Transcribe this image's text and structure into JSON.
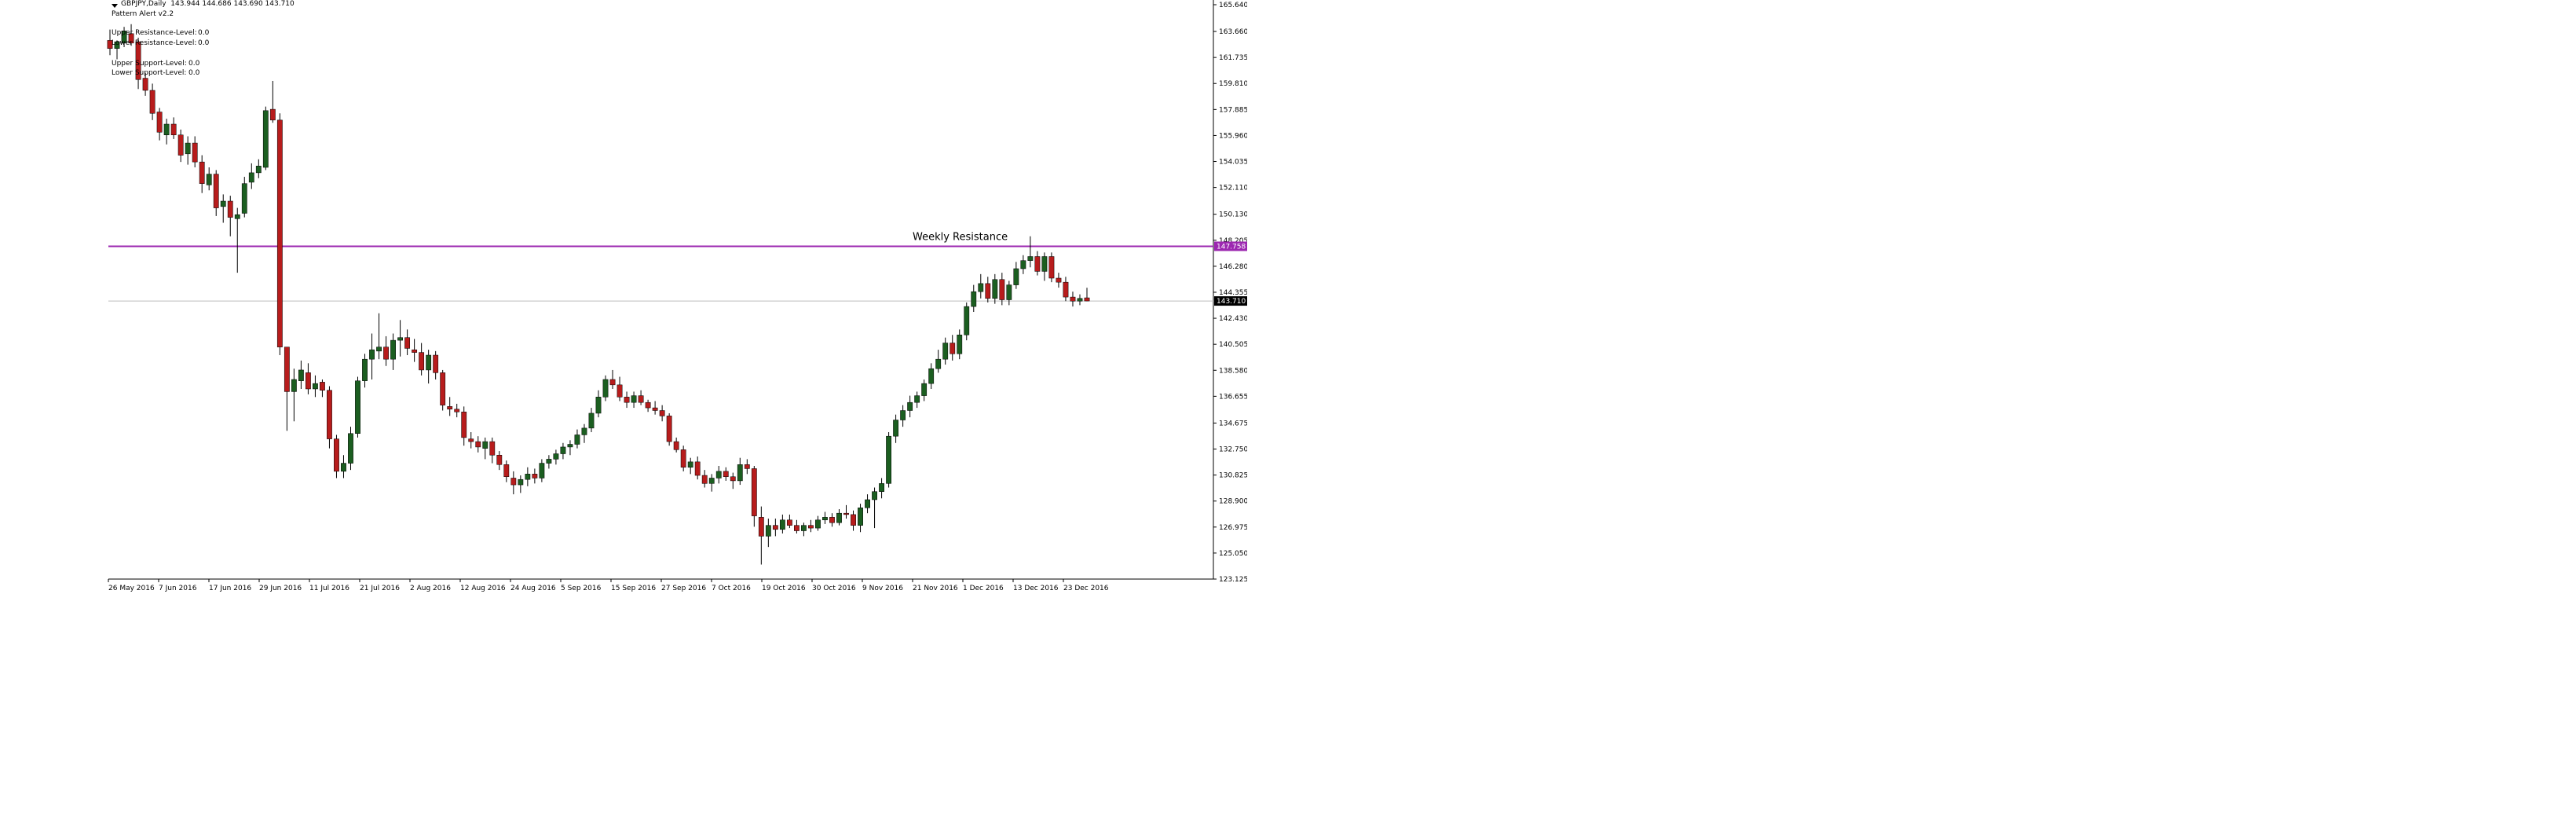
{
  "header": {
    "symbol_line": "GBPJPY,Daily  143.944 144.686 143.690 143.710",
    "pattern_alert": "Pattern Alert v2.2"
  },
  "levels": [
    {
      "label": "Upper Resistance-Level:",
      "value": "0.0"
    },
    {
      "label": "Lower Resistance-Level:",
      "value": "0.0"
    },
    {
      "label": "Upper Support-Level:",
      "value": "0.0"
    },
    {
      "label": "Lower Support-Level:",
      "value": "0.0"
    }
  ],
  "colors": {
    "bull": "#1b5e20",
    "bear": "#b71c1c",
    "wick": "#000000",
    "resistance": "#9c27b0",
    "price_line": "#bdbdbd",
    "axis": "#000000",
    "price_tag_bg": "#000000",
    "resistance_tag_bg": "#9c27b0"
  },
  "chart_data": {
    "type": "candlestick",
    "symbol": "GBPJPY",
    "timeframe": "Daily",
    "y_axis_ticks": [
      "165.640",
      "163.660",
      "161.735",
      "159.810",
      "157.885",
      "155.960",
      "154.035",
      "152.110",
      "150.130",
      "148.205",
      "146.280",
      "144.355",
      "142.430",
      "140.505",
      "138.580",
      "136.655",
      "134.675",
      "132.750",
      "130.825",
      "128.900",
      "126.975",
      "125.050",
      "123.125"
    ],
    "x_axis_ticks": [
      "26 May 2016",
      "7 Jun 2016",
      "17 Jun 2016",
      "29 Jun 2016",
      "11 Jul 2016",
      "21 Jul 2016",
      "2 Aug 2016",
      "12 Aug 2016",
      "24 Aug 2016",
      "5 Sep 2016",
      "15 Sep 2016",
      "27 Sep 2016",
      "7 Oct 2016",
      "19 Oct 2016",
      "30 Oct 2016",
      "9 Nov 2016",
      "21 Nov 2016",
      "1 Dec 2016",
      "13 Dec 2016",
      "23 Dec 2016"
    ],
    "ylim": [
      123.125,
      165.64
    ],
    "weekly_resistance": {
      "value": 147.758,
      "label": "Weekly Resistance",
      "tag": "147.758"
    },
    "current_price": {
      "value": 143.71,
      "tag": "143.710"
    },
    "candles": [
      [
        163.0,
        163.8,
        161.9,
        162.4
      ],
      [
        162.4,
        163.0,
        161.6,
        162.9
      ],
      [
        162.8,
        164.0,
        162.5,
        163.7
      ],
      [
        163.5,
        164.2,
        162.6,
        162.8
      ],
      [
        162.9,
        163.2,
        159.4,
        160.1
      ],
      [
        160.2,
        160.6,
        158.9,
        159.3
      ],
      [
        159.3,
        159.8,
        157.1,
        157.6
      ],
      [
        157.7,
        158.0,
        155.6,
        156.2
      ],
      [
        156.0,
        157.2,
        155.3,
        156.8
      ],
      [
        156.8,
        157.3,
        155.7,
        156.0
      ],
      [
        156.0,
        156.4,
        154.0,
        154.5
      ],
      [
        154.6,
        155.9,
        153.8,
        155.4
      ],
      [
        155.4,
        155.9,
        153.6,
        154.0
      ],
      [
        154.0,
        154.5,
        151.7,
        152.4
      ],
      [
        152.3,
        153.6,
        151.9,
        153.1
      ],
      [
        153.1,
        153.4,
        150.0,
        150.6
      ],
      [
        150.7,
        151.6,
        149.5,
        151.1
      ],
      [
        151.1,
        151.5,
        148.5,
        149.9
      ],
      [
        149.8,
        150.6,
        145.8,
        150.1
      ],
      [
        150.2,
        152.9,
        149.9,
        152.4
      ],
      [
        152.5,
        153.9,
        152.0,
        153.2
      ],
      [
        153.2,
        154.2,
        152.8,
        153.7
      ],
      [
        153.6,
        158.1,
        153.4,
        157.8
      ],
      [
        157.9,
        160.0,
        156.9,
        157.1
      ],
      [
        157.1,
        157.6,
        139.7,
        140.3
      ],
      [
        140.3,
        137.9,
        134.1,
        137.0
      ],
      [
        137.0,
        138.7,
        134.8,
        137.9
      ],
      [
        137.8,
        139.3,
        137.2,
        138.6
      ],
      [
        138.4,
        139.1,
        136.8,
        137.2
      ],
      [
        137.2,
        138.2,
        136.6,
        137.6
      ],
      [
        137.7,
        137.9,
        136.6,
        137.1
      ],
      [
        137.1,
        137.4,
        132.8,
        133.5
      ],
      [
        133.5,
        133.8,
        130.6,
        131.1
      ],
      [
        131.1,
        132.3,
        130.6,
        131.7
      ],
      [
        131.7,
        134.4,
        131.2,
        133.9
      ],
      [
        133.9,
        138.1,
        133.6,
        137.8
      ],
      [
        137.8,
        139.8,
        137.3,
        139.4
      ],
      [
        139.4,
        141.3,
        137.9,
        140.1
      ],
      [
        140.0,
        142.8,
        139.4,
        140.3
      ],
      [
        140.3,
        141.1,
        138.9,
        139.4
      ],
      [
        139.4,
        141.3,
        138.6,
        140.8
      ],
      [
        140.8,
        142.3,
        139.6,
        141.0
      ],
      [
        141.0,
        141.6,
        139.7,
        140.2
      ],
      [
        140.1,
        140.9,
        139.2,
        139.9
      ],
      [
        139.9,
        140.6,
        138.2,
        138.6
      ],
      [
        138.6,
        140.1,
        137.6,
        139.7
      ],
      [
        139.7,
        140.0,
        137.9,
        138.4
      ],
      [
        138.4,
        138.6,
        135.6,
        136.0
      ],
      [
        135.9,
        136.6,
        135.2,
        135.7
      ],
      [
        135.7,
        136.1,
        135.1,
        135.5
      ],
      [
        135.5,
        135.9,
        133.0,
        133.6
      ],
      [
        133.5,
        134.0,
        132.8,
        133.3
      ],
      [
        133.3,
        133.7,
        132.5,
        132.9
      ],
      [
        132.8,
        133.6,
        132.0,
        133.3
      ],
      [
        133.3,
        133.6,
        131.7,
        132.3
      ],
      [
        132.3,
        132.6,
        131.2,
        131.6
      ],
      [
        131.6,
        131.9,
        130.3,
        130.7
      ],
      [
        130.6,
        131.1,
        129.4,
        130.1
      ],
      [
        130.1,
        130.8,
        129.5,
        130.5
      ],
      [
        130.5,
        131.4,
        130.0,
        130.9
      ],
      [
        130.9,
        131.3,
        130.2,
        130.6
      ],
      [
        130.6,
        132.0,
        130.3,
        131.7
      ],
      [
        131.7,
        132.3,
        131.3,
        132.0
      ],
      [
        132.0,
        132.7,
        131.6,
        132.4
      ],
      [
        132.4,
        133.2,
        132.0,
        132.9
      ],
      [
        132.9,
        133.4,
        132.3,
        133.1
      ],
      [
        133.1,
        134.2,
        132.8,
        133.8
      ],
      [
        133.8,
        134.6,
        133.2,
        134.3
      ],
      [
        134.3,
        135.8,
        134.0,
        135.4
      ],
      [
        135.4,
        137.1,
        135.1,
        136.6
      ],
      [
        136.6,
        138.2,
        136.3,
        137.9
      ],
      [
        137.9,
        138.6,
        137.2,
        137.5
      ],
      [
        137.5,
        138.1,
        136.3,
        136.6
      ],
      [
        136.6,
        137.0,
        135.8,
        136.2
      ],
      [
        136.2,
        137.0,
        135.8,
        136.7
      ],
      [
        136.7,
        137.1,
        136.0,
        136.2
      ],
      [
        136.2,
        136.4,
        135.5,
        135.8
      ],
      [
        135.8,
        136.3,
        135.3,
        135.6
      ],
      [
        135.6,
        136.0,
        134.8,
        135.2
      ],
      [
        135.2,
        135.4,
        133.0,
        133.3
      ],
      [
        133.3,
        133.6,
        132.5,
        132.7
      ],
      [
        132.7,
        133.0,
        131.1,
        131.4
      ],
      [
        131.4,
        132.1,
        130.9,
        131.8
      ],
      [
        131.8,
        132.2,
        130.5,
        130.8
      ],
      [
        130.8,
        131.2,
        129.9,
        130.2
      ],
      [
        130.2,
        130.9,
        129.6,
        130.6
      ],
      [
        130.6,
        131.5,
        130.2,
        131.1
      ],
      [
        131.1,
        131.4,
        130.4,
        130.7
      ],
      [
        130.7,
        131.0,
        129.8,
        130.4
      ],
      [
        130.4,
        132.1,
        130.1,
        131.6
      ],
      [
        131.6,
        132.0,
        130.9,
        131.3
      ],
      [
        131.3,
        131.5,
        127.0,
        127.8
      ],
      [
        127.7,
        128.5,
        124.2,
        126.3
      ],
      [
        126.3,
        127.6,
        125.5,
        127.1
      ],
      [
        127.1,
        127.6,
        126.3,
        126.8
      ],
      [
        126.8,
        127.9,
        126.5,
        127.5
      ],
      [
        127.5,
        127.9,
        126.9,
        127.1
      ],
      [
        127.1,
        127.5,
        126.5,
        126.7
      ],
      [
        126.7,
        127.3,
        126.3,
        127.1
      ],
      [
        127.1,
        127.5,
        126.6,
        126.9
      ],
      [
        126.9,
        127.8,
        126.7,
        127.5
      ],
      [
        127.5,
        128.1,
        127.2,
        127.7
      ],
      [
        127.7,
        128.0,
        127.0,
        127.3
      ],
      [
        127.3,
        128.3,
        127.1,
        128.0
      ],
      [
        128.0,
        128.6,
        127.6,
        127.9
      ],
      [
        127.9,
        128.2,
        126.7,
        127.1
      ],
      [
        127.1,
        128.7,
        126.6,
        128.4
      ],
      [
        128.4,
        129.4,
        128.0,
        129.0
      ],
      [
        129.0,
        129.9,
        126.9,
        129.6
      ],
      [
        129.6,
        130.6,
        129.1,
        130.2
      ],
      [
        130.2,
        134.0,
        129.9,
        133.7
      ],
      [
        133.7,
        135.3,
        133.2,
        134.9
      ],
      [
        134.9,
        136.0,
        134.4,
        135.6
      ],
      [
        135.6,
        136.7,
        135.1,
        136.2
      ],
      [
        136.2,
        137.0,
        135.8,
        136.7
      ],
      [
        136.7,
        137.9,
        136.3,
        137.6
      ],
      [
        137.6,
        139.1,
        137.2,
        138.7
      ],
      [
        138.7,
        140.1,
        138.4,
        139.4
      ],
      [
        139.4,
        141.0,
        139.0,
        140.6
      ],
      [
        140.6,
        141.2,
        139.3,
        139.8
      ],
      [
        139.8,
        141.6,
        139.4,
        141.2
      ],
      [
        141.2,
        143.6,
        140.8,
        143.3
      ],
      [
        143.3,
        144.9,
        142.9,
        144.4
      ],
      [
        144.4,
        145.7,
        143.9,
        145.0
      ],
      [
        145.0,
        145.5,
        143.6,
        143.9
      ],
      [
        143.9,
        145.7,
        143.5,
        145.3
      ],
      [
        145.3,
        145.8,
        143.4,
        143.8
      ],
      [
        143.8,
        145.2,
        143.4,
        144.9
      ],
      [
        144.9,
        146.6,
        144.6,
        146.1
      ],
      [
        146.1,
        147.1,
        145.7,
        146.7
      ],
      [
        146.7,
        148.5,
        146.2,
        147.0
      ],
      [
        147.0,
        147.4,
        145.6,
        145.9
      ],
      [
        145.9,
        147.3,
        145.2,
        147.0
      ],
      [
        147.0,
        147.3,
        145.1,
        145.4
      ],
      [
        145.4,
        145.8,
        144.7,
        145.1
      ],
      [
        145.1,
        145.5,
        143.7,
        144.0
      ],
      [
        144.0,
        144.4,
        143.3,
        143.7
      ],
      [
        143.7,
        144.2,
        143.4,
        143.9
      ],
      [
        143.944,
        144.686,
        143.69,
        143.71
      ]
    ]
  }
}
